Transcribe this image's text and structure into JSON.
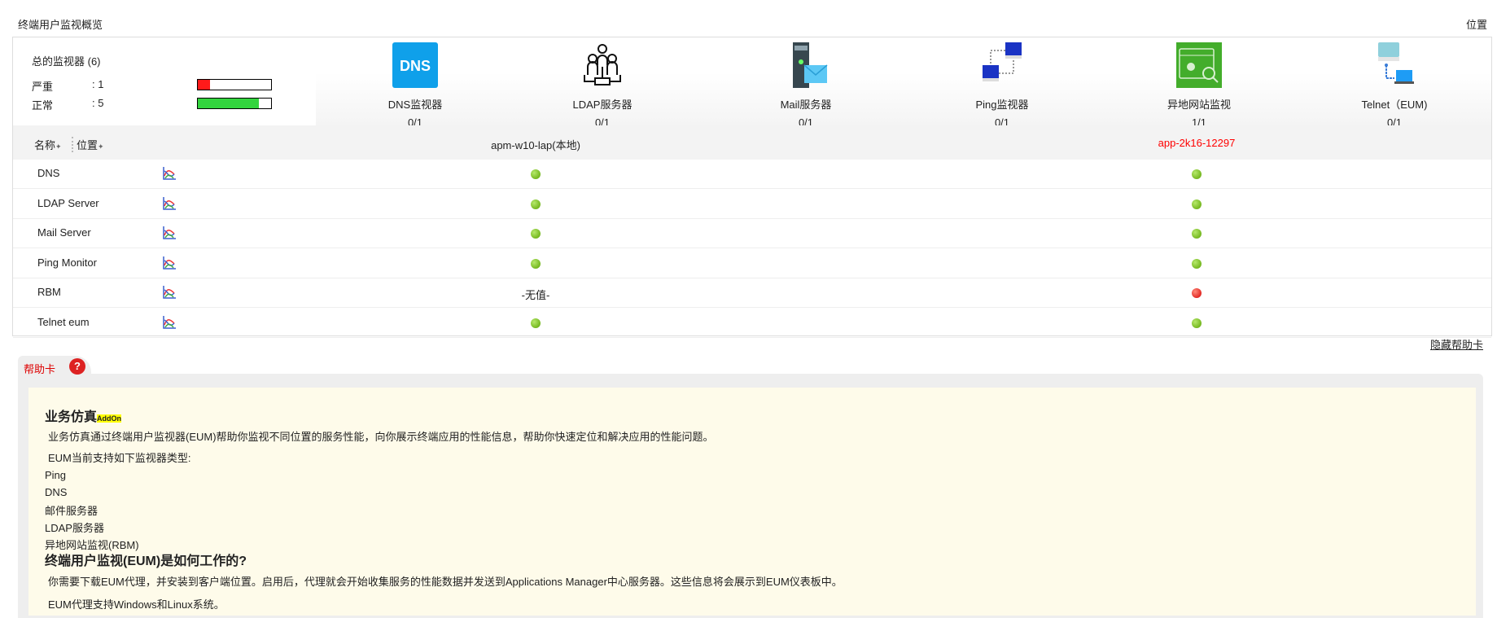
{
  "page": {
    "title": "终端用户监视概览",
    "location_link": "位置"
  },
  "summary": {
    "title": "总的监视器 (6)",
    "rows": [
      {
        "label": "严重",
        "value": ": 1",
        "fraction": 0.167,
        "color": "#ff1a1a"
      },
      {
        "label": "正常",
        "value": ": 5",
        "fraction": 0.833,
        "color": "#33d43e"
      }
    ]
  },
  "types": [
    {
      "name": "DNS监视器",
      "count": "0/1",
      "icon": "dns-icon"
    },
    {
      "name": "LDAP服务器",
      "count": "0/1",
      "icon": "ldap-icon"
    },
    {
      "name": "Mail服务器",
      "count": "0/1",
      "icon": "mail-server-icon"
    },
    {
      "name": "Ping监视器",
      "count": "0/1",
      "icon": "ping-icon"
    },
    {
      "name": "异地网站监视",
      "count": "1/1",
      "icon": "rbm-icon"
    },
    {
      "name": "Telnet（EUM)",
      "count": "0/1",
      "icon": "telnet-icon"
    }
  ],
  "table": {
    "col_name": "名称",
    "col_location": "位置",
    "locations": [
      "apm-w10-lap(本地)",
      "app-2k16-12297"
    ],
    "rows": [
      {
        "name": "DNS",
        "status": [
          "green",
          "green"
        ]
      },
      {
        "name": "LDAP Server",
        "status": [
          "green",
          "green"
        ]
      },
      {
        "name": "Mail Server",
        "status": [
          "green",
          "green"
        ]
      },
      {
        "name": "Ping Monitor",
        "status": [
          "green",
          "green"
        ]
      },
      {
        "name": "RBM",
        "status": [
          "-无值-",
          "red"
        ]
      },
      {
        "name": "Telnet eum",
        "status": [
          "green",
          "green"
        ]
      }
    ]
  },
  "help": {
    "hide_label": "隐藏帮助卡",
    "tab_label": "帮助卡",
    "q": "?",
    "h1": "业务仿真",
    "addon": "AddOn",
    "p1": "业务仿真通过终端用户监视器(EUM)帮助你监视不同位置的服务性能，向你展示终端应用的性能信息，帮助你快速定位和解决应用的性能问题。",
    "p2": "EUM当前支持如下监视器类型:",
    "list": [
      "Ping",
      "DNS",
      "邮件服务器",
      "LDAP服务器",
      "异地网站监视(RBM)"
    ],
    "h2": "终端用户监视(EUM)是如何工作的?",
    "p3": "你需要下载EUM代理，并安装到客户端位置。启用后，代理就会开始收集服务的性能数据并发送到Applications Manager中心服务器。这些信息将会展示到EUM仪表板中。",
    "p4": "EUM代理支持Windows和Linux系统。"
  }
}
